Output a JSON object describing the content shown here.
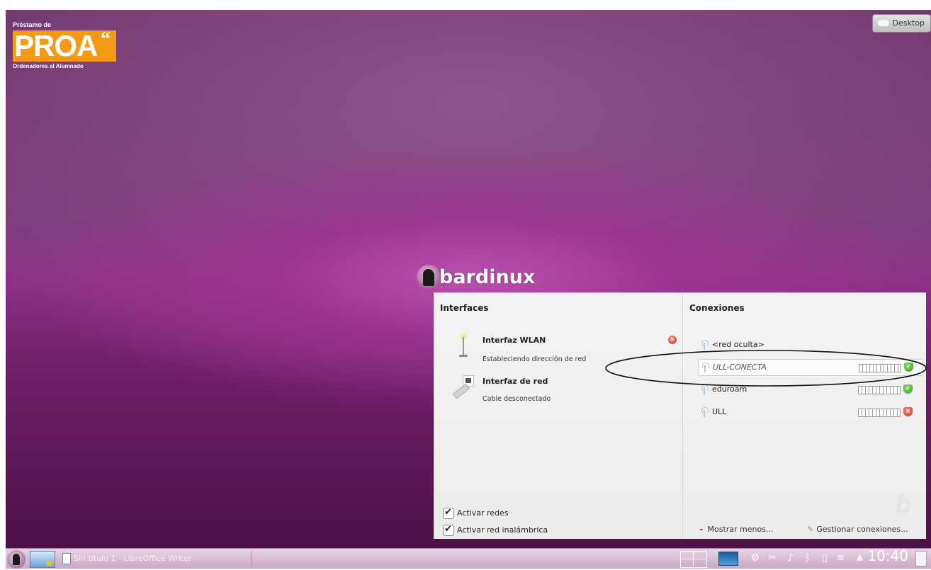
{
  "desktop": {
    "brand_top": "Préstamo de",
    "brand_logo": "PROA",
    "brand_quote": "“",
    "brand_bottom": "Ordenadores al Alumnado",
    "desktop_button": "Desktop",
    "distro_name": "bardinux"
  },
  "network_panel": {
    "interfaces_title": "Interfaces",
    "connections_title": "Conexiones",
    "interfaces": [
      {
        "name": "Interfaz WLAN",
        "status": "Estableciendo dirección de red"
      },
      {
        "name": "Interfaz de red",
        "status": "Cable desconectado"
      }
    ],
    "connections": [
      {
        "name": "<red oculta>",
        "selected": false
      },
      {
        "name": "ULL-CONECTA",
        "selected": true,
        "security": "ok"
      },
      {
        "name": "eduroam",
        "selected": false,
        "security": "ok"
      },
      {
        "name": "ULL",
        "selected": false,
        "security": "bad"
      }
    ],
    "checkboxes": [
      {
        "label": "Activar redes",
        "checked": true
      },
      {
        "label": "Activar red inalámbrica",
        "checked": true
      }
    ],
    "show_less": "Mostrar menos...",
    "manage_connections": "Gestionar conexiones..."
  },
  "taskbar": {
    "task_title": "Sin título 1 - LibreOffice Writer",
    "clock": "10:40"
  },
  "colors": {
    "accent_orange": "#f49a15",
    "panel_bg": "#efefef",
    "desktop_purple": "#8d2f86"
  }
}
